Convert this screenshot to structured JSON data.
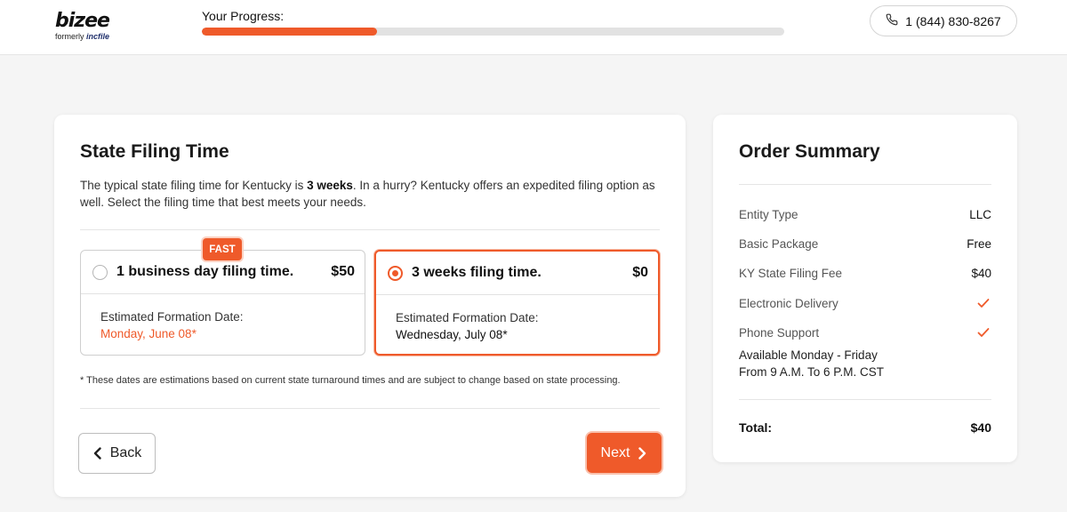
{
  "brand": {
    "logo_text": "bizee",
    "formerly_text": "formerly",
    "formerly_name": "incfile"
  },
  "progress": {
    "label": "Your Progress:",
    "fraction": 0.3
  },
  "phone": {
    "number": "1 (844) 830-8267",
    "icon": "phone-icon"
  },
  "colors": {
    "accent": "#ef5a2a"
  },
  "filing": {
    "title": "State Filing Time",
    "desc_before": "The typical state filing time for Kentucky is ",
    "desc_bold": "3 weeks",
    "desc_after": ". In a hurry? Kentucky offers an expedited filing option as well. Select the filing time that best meets your needs.",
    "badge": "FAST",
    "options": [
      {
        "label": "1 business day filing time.",
        "price": "$50",
        "est_label": "Estimated Formation Date:",
        "est_date": "Monday, June 08*",
        "selected": false
      },
      {
        "label": "3 weeks filing time.",
        "price": "$0",
        "est_label": "Estimated Formation Date:",
        "est_date": "Wednesday, July 08*",
        "selected": true
      }
    ],
    "footnote": "* These dates are estimations based on current state turnaround times and are subject to change based on state processing.",
    "back_label": "Back",
    "next_label": "Next"
  },
  "summary": {
    "title": "Order Summary",
    "rows": [
      {
        "key": "Entity Type",
        "value": "LLC"
      },
      {
        "key": "Basic Package",
        "value": "Free"
      },
      {
        "key": "KY State Filing Fee",
        "value": "$40"
      },
      {
        "key": "Electronic Delivery",
        "value": "check"
      },
      {
        "key": "Phone Support",
        "value": "check"
      }
    ],
    "availability_line1": "Available Monday - Friday",
    "availability_line2": "From 9 A.M. To 6 P.M. CST",
    "total_label": "Total:",
    "total_value": "$40"
  }
}
